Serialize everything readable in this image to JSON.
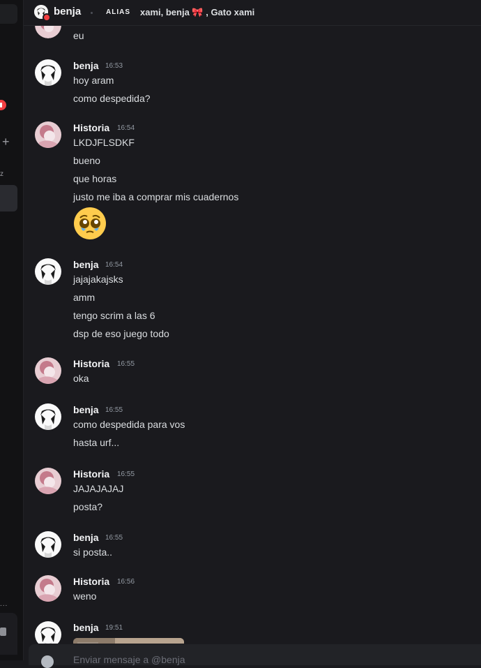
{
  "header": {
    "username": "benja",
    "alias_label": "ALIAS",
    "aliases": "xami, benja 🎀 , Gato xami"
  },
  "sidebar": {
    "letter": "z",
    "dots": "..."
  },
  "top_line": "eu",
  "messages": [
    {
      "author": "benja",
      "time": "16:53",
      "lines": [
        "hoy aram",
        "como despedida?"
      ]
    },
    {
      "author": "Historia",
      "time": "16:54",
      "lines": [
        "LKDJFLSDKF",
        "bueno",
        "que horas",
        "justo me iba a comprar mis cuadernos"
      ],
      "emoji": "pleading-face"
    },
    {
      "author": "benja",
      "time": "16:54",
      "lines": [
        "jajajakajsks",
        "amm",
        "tengo scrim a las 6",
        "dsp de eso juego todo"
      ]
    },
    {
      "author": "Historia",
      "time": "16:55",
      "lines": [
        "oka"
      ]
    },
    {
      "author": "benja",
      "time": "16:55",
      "lines": [
        "como despedida para vos",
        "hasta urf..."
      ]
    },
    {
      "author": "Historia",
      "time": "16:55",
      "lines": [
        "JAJAJAJAJ",
        "posta?"
      ]
    },
    {
      "author": "benja",
      "time": "16:55",
      "lines": [
        "si posta.."
      ]
    },
    {
      "author": "Historia",
      "time": "16:56",
      "lines": [
        "weno"
      ]
    },
    {
      "author": "benja",
      "time": "19:51",
      "lines": [],
      "attachment": "image"
    }
  ],
  "composer": {
    "placeholder": "Enviar mensaje a @benja"
  },
  "colors": {
    "background": "#1a1a1e",
    "sidebar": "#121214",
    "text": "#dbdee1",
    "username": "#f2f3f5",
    "timestamp": "#949ba4",
    "status_dnd": "#f23f42"
  }
}
